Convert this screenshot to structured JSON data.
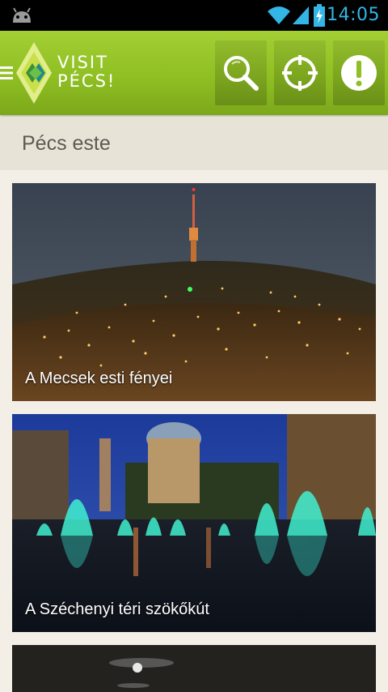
{
  "status_bar": {
    "icons": [
      "android-debug-icon",
      "wifi-icon",
      "signal-icon",
      "battery-charging-icon"
    ],
    "time": "14:05",
    "accent_color": "#33b5e5"
  },
  "action_bar": {
    "logo_line1": "VISIT",
    "logo_line2": "PÉCS!",
    "buttons": [
      "search-icon",
      "locate-icon",
      "info-icon"
    ],
    "brand_color": "#8fbf23"
  },
  "section": {
    "title": "Pécs este"
  },
  "cards": [
    {
      "title": "A Mecsek esti fényei"
    },
    {
      "title": "A Széchenyi téri szökőkút"
    },
    {
      "title": ""
    }
  ]
}
